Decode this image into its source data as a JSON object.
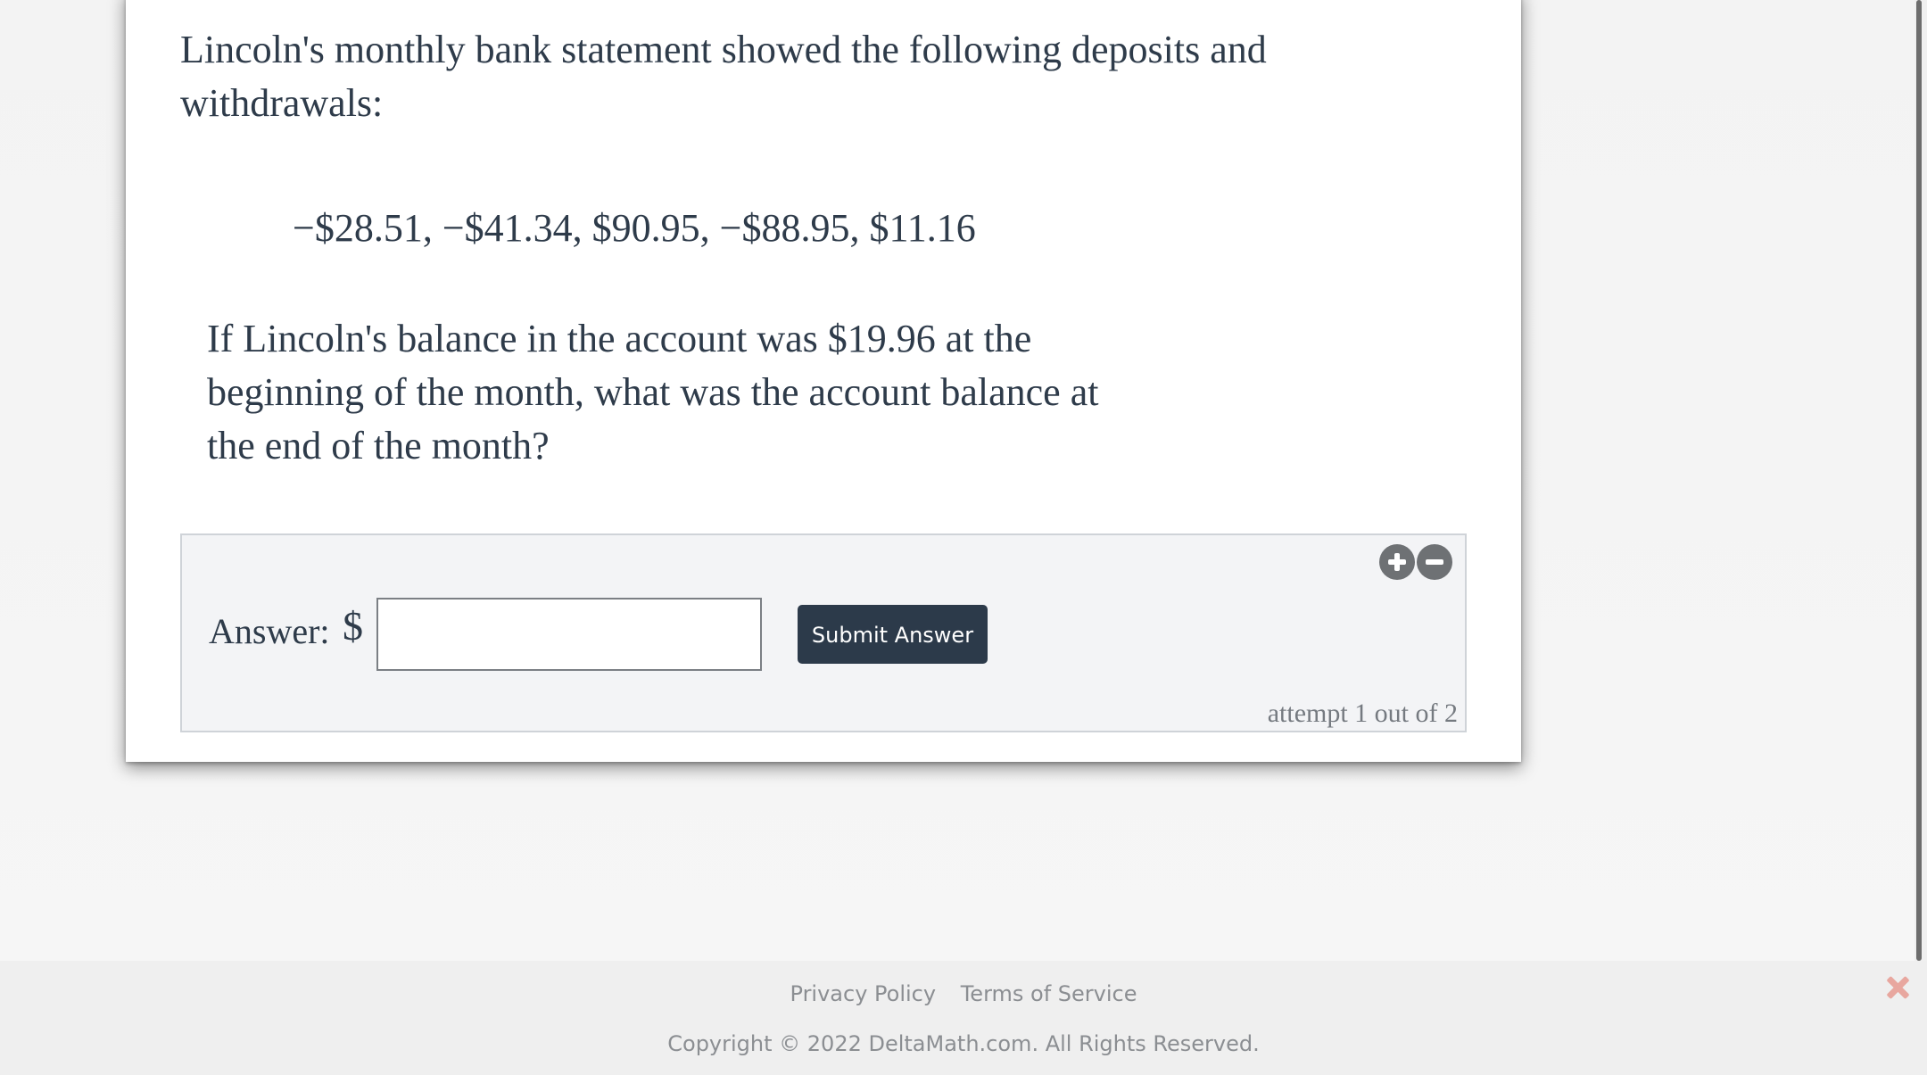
{
  "problem": {
    "intro": "Lincoln's monthly bank statement showed the following deposits and withdrawals:",
    "values": "−$28.51, −$41.34, $90.95, −$88.95, $11.16",
    "question": "If Lincoln's balance in the account was $19.96 at the beginning of the month, what was the account balance at the end of the month?"
  },
  "answer": {
    "label": "Answer:",
    "currency_symbol": "$",
    "input_value": "",
    "submit_label": "Submit Answer",
    "attempt_text": "attempt 1 out of 2",
    "zoom_in_icon": "plus-circle-icon",
    "zoom_out_icon": "minus-circle-icon"
  },
  "footer": {
    "privacy_label": "Privacy Policy",
    "terms_label": "Terms of Service",
    "copyright": "Copyright © 2022 DeltaMath.com. All Rights Reserved.",
    "close_icon": "close-icon"
  },
  "colors": {
    "primary_text": "#2e3b4a",
    "submit_button": "#2c3a4a",
    "close_icon": "#e8a79f",
    "muted_text": "#8b8e92"
  }
}
